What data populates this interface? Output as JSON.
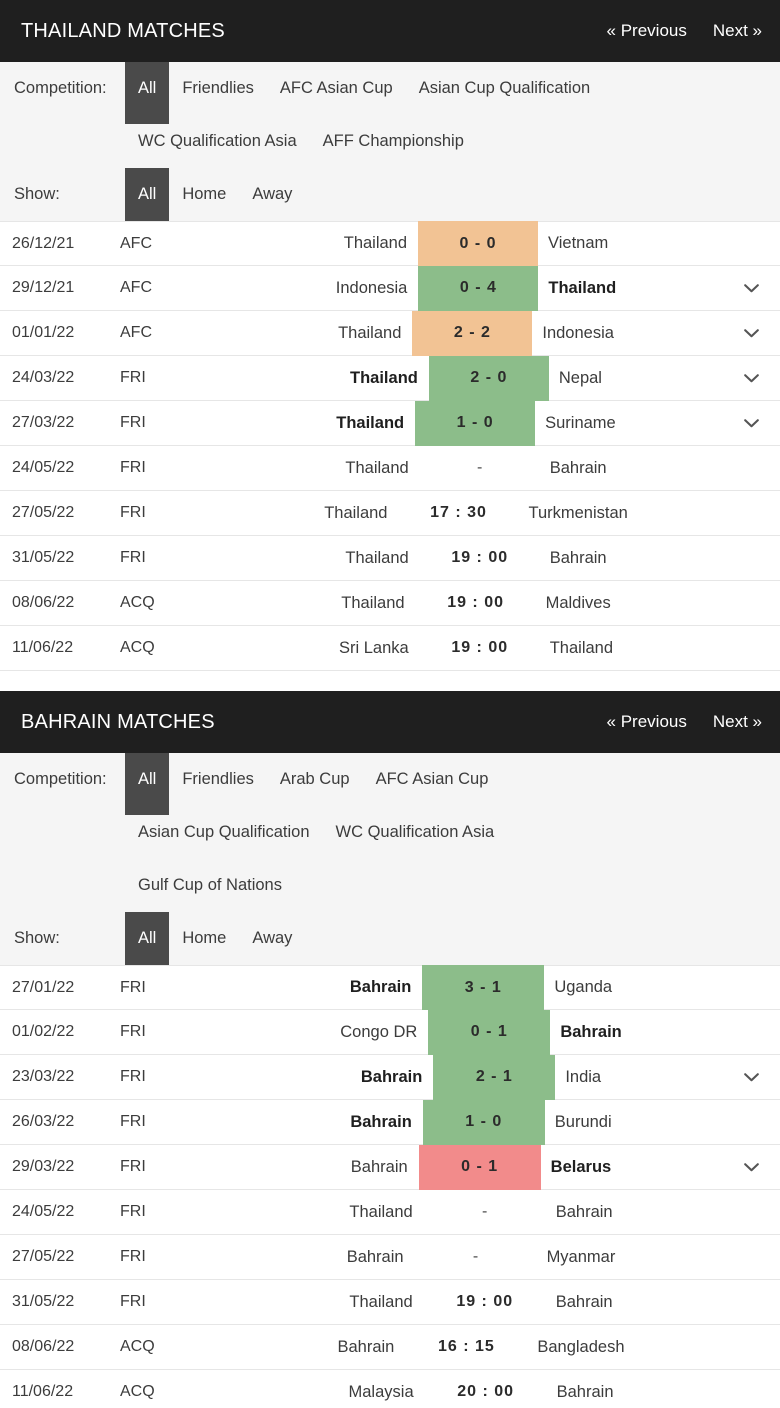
{
  "sections": [
    {
      "id": "thailand",
      "title": "THAILAND MATCHES",
      "nav": {
        "previous": "« Previous",
        "next": "Next »"
      },
      "filters": {
        "competition_label": "Competition:",
        "show_label": "Show:",
        "competition_row1": [
          "All",
          "Friendlies",
          "AFC Asian Cup",
          "Asian Cup Qualification"
        ],
        "competition_row2": [
          "WC Qualification Asia",
          "AFF Championship"
        ],
        "competition_active": "All",
        "show_options": [
          "All",
          "Home",
          "Away"
        ],
        "show_active": "All"
      },
      "matches": [
        {
          "date": "26/12/21",
          "comp": "AFC",
          "home": "Thailand",
          "home_bold": false,
          "score": "0 - 0",
          "result": "draw",
          "away": "Vietnam",
          "away_bold": false,
          "chevron": false
        },
        {
          "date": "29/12/21",
          "comp": "AFC",
          "home": "Indonesia",
          "home_bold": false,
          "score": "0 - 4",
          "result": "win",
          "away": "Thailand",
          "away_bold": true,
          "chevron": true
        },
        {
          "date": "01/01/22",
          "comp": "AFC",
          "home": "Thailand",
          "home_bold": false,
          "score": "2 - 2",
          "result": "draw",
          "away": "Indonesia",
          "away_bold": false,
          "chevron": true
        },
        {
          "date": "24/03/22",
          "comp": "FRI",
          "home": "Thailand",
          "home_bold": true,
          "score": "2 - 0",
          "result": "win",
          "away": "Nepal",
          "away_bold": false,
          "chevron": true
        },
        {
          "date": "27/03/22",
          "comp": "FRI",
          "home": "Thailand",
          "home_bold": true,
          "score": "1 - 0",
          "result": "win",
          "away": "Suriname",
          "away_bold": false,
          "chevron": true
        },
        {
          "date": "24/05/22",
          "comp": "FRI",
          "home": "Thailand",
          "home_bold": false,
          "score": "-",
          "result": "none",
          "away": "Bahrain",
          "away_bold": false,
          "chevron": false
        },
        {
          "date": "27/05/22",
          "comp": "FRI",
          "home": "Thailand",
          "home_bold": false,
          "score": "17 : 30",
          "result": "time",
          "away": "Turkmenistan",
          "away_bold": false,
          "chevron": false
        },
        {
          "date": "31/05/22",
          "comp": "FRI",
          "home": "Thailand",
          "home_bold": false,
          "score": "19 : 00",
          "result": "time",
          "away": "Bahrain",
          "away_bold": false,
          "chevron": false
        },
        {
          "date": "08/06/22",
          "comp": "ACQ",
          "home": "Thailand",
          "home_bold": false,
          "score": "19 : 00",
          "result": "time",
          "away": "Maldives",
          "away_bold": false,
          "chevron": false
        },
        {
          "date": "11/06/22",
          "comp": "ACQ",
          "home": "Sri Lanka",
          "home_bold": false,
          "score": "19 : 00",
          "result": "time",
          "away": "Thailand",
          "away_bold": false,
          "chevron": false
        }
      ]
    },
    {
      "id": "bahrain",
      "title": "BAHRAIN MATCHES",
      "nav": {
        "previous": "« Previous",
        "next": "Next »"
      },
      "filters": {
        "competition_label": "Competition:",
        "show_label": "Show:",
        "competition_row1": [
          "All",
          "Friendlies",
          "Arab Cup",
          "AFC Asian Cup"
        ],
        "competition_row2": [
          "Asian Cup Qualification",
          "WC Qualification Asia"
        ],
        "competition_row3": [
          "Gulf Cup of Nations"
        ],
        "competition_active": "All",
        "show_options": [
          "All",
          "Home",
          "Away"
        ],
        "show_active": "All"
      },
      "matches": [
        {
          "date": "27/01/22",
          "comp": "FRI",
          "home": "Bahrain",
          "home_bold": true,
          "score": "3 - 1",
          "result": "win",
          "away": "Uganda",
          "away_bold": false,
          "chevron": false
        },
        {
          "date": "01/02/22",
          "comp": "FRI",
          "home": "Congo DR",
          "home_bold": false,
          "score": "0 - 1",
          "result": "win",
          "away": "Bahrain",
          "away_bold": true,
          "chevron": false
        },
        {
          "date": "23/03/22",
          "comp": "FRI",
          "home": "Bahrain",
          "home_bold": true,
          "score": "2 - 1",
          "result": "win",
          "away": "India",
          "away_bold": false,
          "chevron": true
        },
        {
          "date": "26/03/22",
          "comp": "FRI",
          "home": "Bahrain",
          "home_bold": true,
          "score": "1 - 0",
          "result": "win",
          "away": "Burundi",
          "away_bold": false,
          "chevron": false
        },
        {
          "date": "29/03/22",
          "comp": "FRI",
          "home": "Bahrain",
          "home_bold": false,
          "score": "0 - 1",
          "result": "loss",
          "away": "Belarus",
          "away_bold": true,
          "chevron": true
        },
        {
          "date": "24/05/22",
          "comp": "FRI",
          "home": "Thailand",
          "home_bold": false,
          "score": "-",
          "result": "none",
          "away": "Bahrain",
          "away_bold": false,
          "chevron": false
        },
        {
          "date": "27/05/22",
          "comp": "FRI",
          "home": "Bahrain",
          "home_bold": false,
          "score": "-",
          "result": "none",
          "away": "Myanmar",
          "away_bold": false,
          "chevron": false
        },
        {
          "date": "31/05/22",
          "comp": "FRI",
          "home": "Thailand",
          "home_bold": false,
          "score": "19 : 00",
          "result": "time",
          "away": "Bahrain",
          "away_bold": false,
          "chevron": false
        },
        {
          "date": "08/06/22",
          "comp": "ACQ",
          "home": "Bahrain",
          "home_bold": false,
          "score": "16 : 15",
          "result": "time",
          "away": "Bangladesh",
          "away_bold": false,
          "chevron": false
        },
        {
          "date": "11/06/22",
          "comp": "ACQ",
          "home": "Malaysia",
          "home_bold": false,
          "score": "20 : 00",
          "result": "time",
          "away": "Bahrain",
          "away_bold": false,
          "chevron": false
        }
      ]
    }
  ],
  "colors": {
    "win": "#8cbd8a",
    "draw": "#f2c394",
    "loss": "#f28b8b",
    "header_bg": "#1f1f1f",
    "chip_active_bg": "#4a4a4a",
    "filter_bg": "#f5f5f5"
  },
  "icons": {
    "chevron_down": "chevron-down-icon"
  }
}
